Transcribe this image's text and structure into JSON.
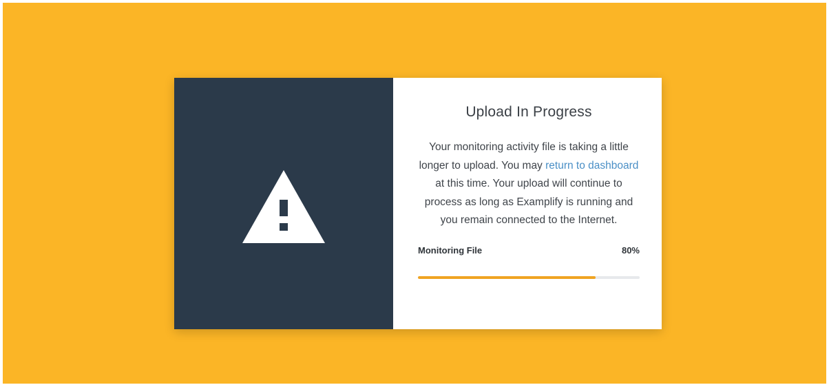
{
  "colors": {
    "background": "#FBB526",
    "panel_dark": "#2B3A4A",
    "link": "#4A8FC6",
    "progress": "#F0A422"
  },
  "dialog": {
    "icon": "warning-triangle-icon",
    "title": "Upload In Progress",
    "message": {
      "before_link": "Your monitoring activity file is taking a little longer to upload. You may ",
      "link_text": "return to dashboard",
      "after_link": " at this time. Your upload will continue to process as long as Examplify is running and you remain connected to the Internet."
    },
    "progress": {
      "label": "Monitoring File",
      "percent_text": "80%",
      "value": 0.8
    }
  }
}
